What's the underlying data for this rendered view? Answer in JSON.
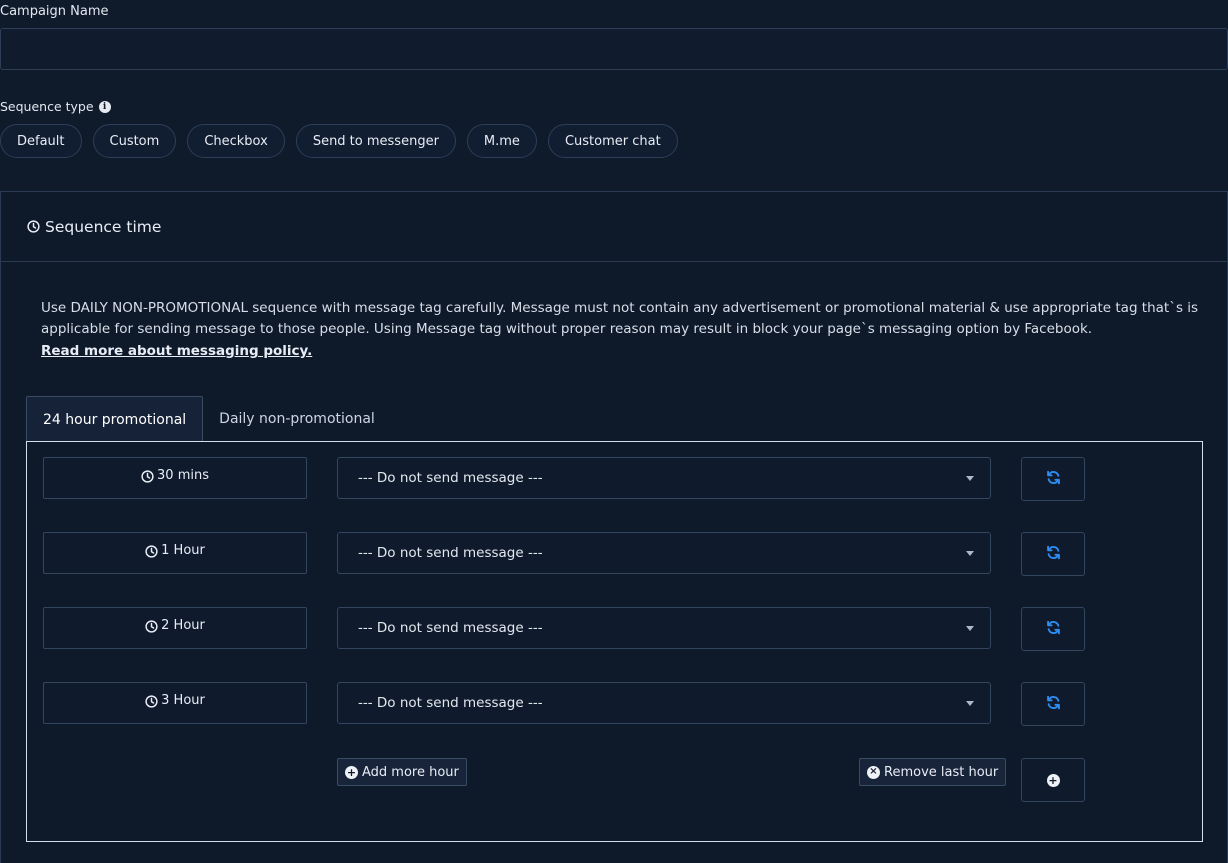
{
  "campaign": {
    "label": "Campaign Name",
    "value": "",
    "placeholder": ""
  },
  "sequence_type": {
    "label": "Sequence type",
    "info_icon": "info-icon",
    "options": [
      "Default",
      "Custom",
      "Checkbox",
      "Send to messenger",
      "M.me",
      "Customer chat"
    ]
  },
  "sequence_time": {
    "title": "Sequence time",
    "title_icon": "clock-icon",
    "notice_text": "Use DAILY NON-PROMOTIONAL sequence with message tag carefully. Message must not contain any advertisement or promotional material & use appropriate tag that`s is applicable for sending message to those people. Using Message tag without proper reason may result in block your page`s messaging option by Facebook.",
    "notice_link": "Read more about messaging policy.",
    "tabs": [
      {
        "label": "24 hour promotional",
        "active": true
      },
      {
        "label": "Daily non-promotional",
        "active": false
      }
    ],
    "rows": [
      {
        "time": "30 mins",
        "selected": "--- Do not send message ---"
      },
      {
        "time": "1 Hour",
        "selected": "--- Do not send message ---"
      },
      {
        "time": "2 Hour",
        "selected": "--- Do not send message ---"
      },
      {
        "time": "3 Hour",
        "selected": "--- Do not send message ---"
      }
    ],
    "add_more_label": "Add more hour",
    "remove_last_label": "Remove last hour"
  },
  "colors": {
    "background": "#0f1a2b",
    "border": "#34455f",
    "accent_blue": "#2f8cf0",
    "text": "#e8edf5"
  }
}
